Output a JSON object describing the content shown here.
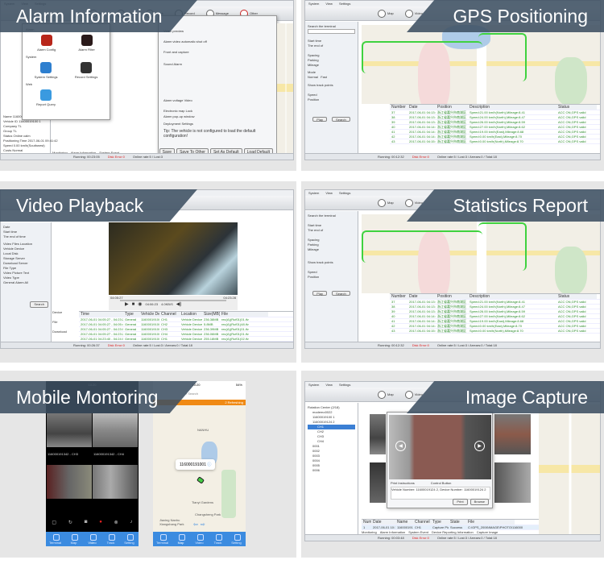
{
  "panels": {
    "alarm": {
      "title": "Alarm Information",
      "menu": [
        "System",
        "View",
        "Settings"
      ],
      "toolbar": [
        "Map",
        "Video",
        "Track",
        "Record",
        "Message",
        "Other"
      ],
      "dialog": {
        "sections": [
          "Alarm",
          "System",
          "Web"
        ],
        "items": [
          "Alarm Config",
          "Alarm Filter",
          "System Settings",
          "Record Settings",
          "Report Query"
        ]
      },
      "settings": [
        "Video preview",
        "Alarm video automatic shut off",
        "Front and capture",
        "Sound Alarm",
        "Alarm voltage Video",
        "Electronic map Lock",
        "Alarm pop-up window"
      ],
      "deployment": "Deployment Settings",
      "tip": "Tip: The vehicle is not configured to load the default configuration!",
      "buttons": [
        "Save",
        "Save To Other",
        "Set As Default",
        "Load Default"
      ],
      "info": [
        [
          "Name",
          "11600019100 1"
        ],
        [
          "Vehicle ID",
          "11600019100 1"
        ],
        [
          "Company",
          "TL"
        ],
        [
          "Group",
          "TL"
        ],
        [
          "Status",
          "Online calm"
        ],
        [
          "Positioning Time",
          "2017-06-01 09:41:42"
        ],
        [
          "Speed",
          "0.00 km/h(Southwest)"
        ],
        [
          "Costs",
          "Normal"
        ]
      ],
      "tabs": [
        "Monitoring",
        "Alarm Information",
        "System Event"
      ],
      "status": {
        "running": "Running: 00:23:05",
        "err": "Disk Error:0",
        "online": "Online rate:5 / Lost:3"
      }
    },
    "gps": {
      "title": "GPS Positioning",
      "menu": [
        "System",
        "View",
        "Settings"
      ],
      "toolbar": [
        "Map",
        "Video"
      ],
      "form": {
        "search": "Search the terminal",
        "start": "Start time",
        "end": "The end of",
        "spacing": "Spacing",
        "parking": "Parking",
        "mileage": "Mileage",
        "mode": "Mode",
        "normal": "Normal",
        "fast": "Fast",
        "show": "Show track points",
        "speed": "Speed",
        "position": "Position",
        "play": "Play",
        "search_btn": "Search"
      },
      "columns": [
        "Number",
        "Date",
        "Position",
        "Description",
        "Status"
      ],
      "rows": [
        [
          "37",
          "2017-06-01 04:13:06",
          "浙江省嘉兴市南湖区",
          "Speed:21.00 km/h(North),Mileage:8.41",
          "ACC ON,GPS valid"
        ],
        [
          "38",
          "2017-06-01 04:13:26",
          "浙江省嘉兴市南湖区",
          "Speed:24.00 km/h(North),Mileage:8.47",
          "ACC ON,GPS valid"
        ],
        [
          "39",
          "2017-06-01 04:13:46",
          "浙江省嘉兴市南湖区",
          "Speed:26.00 km/h(North),Mileage:8.59",
          "ACC ON,GPS valid"
        ],
        [
          "40",
          "2017-06-01 04:14:06",
          "浙江省嘉兴市南湖区",
          "Speed:27.00 km/h(North),Mileage:8.62",
          "ACC ON,GPS valid"
        ],
        [
          "41",
          "2017-06-01 04:14:26",
          "浙江省嘉兴市南湖区",
          "Speed:19.00 km/h(East),Mileage:8.68",
          "ACC ON,GPS valid"
        ],
        [
          "42",
          "2017-06-01 04:14:46",
          "浙江省嘉兴市南湖区",
          "Speed:0.00 km/h(East),Mileage:8.70",
          "ACC ON,GPS valid"
        ],
        [
          "43",
          "2017-06-01 04:15:06",
          "浙江省嘉兴市南湖区",
          "Speed:0.00 km/h(North),Mileage:8.70",
          "ACC ON,GPS valid"
        ]
      ],
      "status": {
        "running": "Running: 00:12:32",
        "err": "Disk Error:0",
        "online": "Online rate:5 / Lost:3 / Arrears:0 / Total:18"
      }
    },
    "video": {
      "title": "Video Playback",
      "form": {
        "date": "Date",
        "start": "Start time",
        "end": "The end of time",
        "location": "Video Files Location",
        "options": [
          "Vehicle Device",
          "Local Disk",
          "Storage Server",
          "Download Server"
        ],
        "filetype": "File Type",
        "types": [
          "Video",
          "Picture",
          "Text"
        ],
        "videotype": "Video Type",
        "vtypes": [
          "General",
          "Alarm",
          "All"
        ],
        "search": "Search"
      },
      "player": {
        "time_start": "04:05:27",
        "time_end": "04:23:28",
        "cur": "04:06:23",
        "size": "4.0KB/S"
      },
      "sidebtns": [
        "Device",
        "File",
        "Download"
      ],
      "columns": [
        "Time",
        "Type",
        "Vehicle Device",
        "Channel",
        "Location",
        "Size(MB)",
        "File"
      ],
      "rows": [
        [
          "2017-06-01 04:05:27 - 04:23:28",
          "General",
          "11600019100 1",
          "CH1",
          "Vehicle Device",
          "236.38MB",
          "rec(A)(Ruf01)01.ifv"
        ],
        [
          "2017-06-01 04:05:27 - 04:05:40",
          "General",
          "11600019100 1",
          "CH2",
          "Vehicle Device",
          "5.8MB",
          "rec(A)(Ruf01)48.ifv"
        ],
        [
          "2017-06-01 04:05:27 - 04:23:01",
          "General",
          "11600019100 1",
          "CH3",
          "Vehicle Device",
          "236.39MB",
          "rec(A)(Ruf01)01.ifv"
        ],
        [
          "2017-06-01 04:05:27 - 04:23:28",
          "General",
          "11600019100 1",
          "CH4",
          "Vehicle Device",
          "236.06MB",
          "rec(A)(Ruf01)01.ifv"
        ],
        [
          "2017-06-01 04:23:40 - 04:24:07",
          "General",
          "11600019100 1",
          "CH1",
          "Vehicle Device",
          "255.18MB",
          "rec(A)(Ruf01)02.ifv"
        ]
      ],
      "status": {
        "running": "Running: 00:26:37",
        "err": "Disk Error:0",
        "online": "Online rate:5 / Lost:3 / Arrears:0 / Total:18"
      }
    },
    "stats": {
      "title": "Statistics Report"
    },
    "mobile": {
      "title": "Mobile Montoring",
      "time": "10:20",
      "battery": "54%",
      "search": "Search",
      "refresh": "2 Refreshing",
      "vehicle": "116000191001",
      "cams": [
        "116000191342 - CH3",
        "116000191342 - CH4"
      ],
      "tabs": [
        "Terminal",
        "Map",
        "Video",
        "Track",
        "Setting"
      ],
      "places": [
        "NANHU",
        "Jiaxing Nanhu Xiangshang Park",
        "Changsheng Park",
        "Tianyi Gardens"
      ]
    },
    "capture": {
      "title": "Image Capture",
      "menu": [
        "System",
        "View",
        "Settings"
      ],
      "toolbar": [
        "Map",
        "Video"
      ],
      "tree": [
        "Rotation Center (2/18)",
        "modemo0022",
        "11600019100 1",
        "11600019124 2",
        "CH1",
        "CH2",
        "CH3",
        "CH4",
        "0001",
        "0002",
        "0003",
        "0004",
        "0005",
        "0006"
      ],
      "dialog": {
        "chk1": "Print Instructions",
        "chk2": "Control Button",
        "info": "Vehicle Number: 11600019124 2, Device Number: 11600019124 2",
        "print": "Print",
        "browse": "Browse"
      },
      "columns": [
        "Number",
        "Date",
        "Name",
        "Channel",
        "Type",
        "State",
        "File"
      ],
      "row": [
        "1",
        "2017-06-01 10:13:02",
        "11600019124 2",
        "CH1",
        "Capture Pictures",
        "Success",
        "C:\\GPS_2006\\IMAGE\\PHOTO\\11600019124 2.jpg"
      ],
      "tabs": [
        "Monitoring",
        "Alarm Information",
        "System Event",
        "Device Reporting Information",
        "Capture Image"
      ],
      "status": {
        "running": "Running: 00:03:48",
        "err": "Disk Error:0",
        "online": "Online rate:5 / Lost:3 / Arrears:0 / Total:18"
      }
    }
  },
  "colors": {
    "banner": "#3e5062",
    "accent_green": "#3fd23f",
    "tabbar_blue": "#3b8be0",
    "orange_bar": "#f08a14",
    "error_red": "#d22222"
  }
}
